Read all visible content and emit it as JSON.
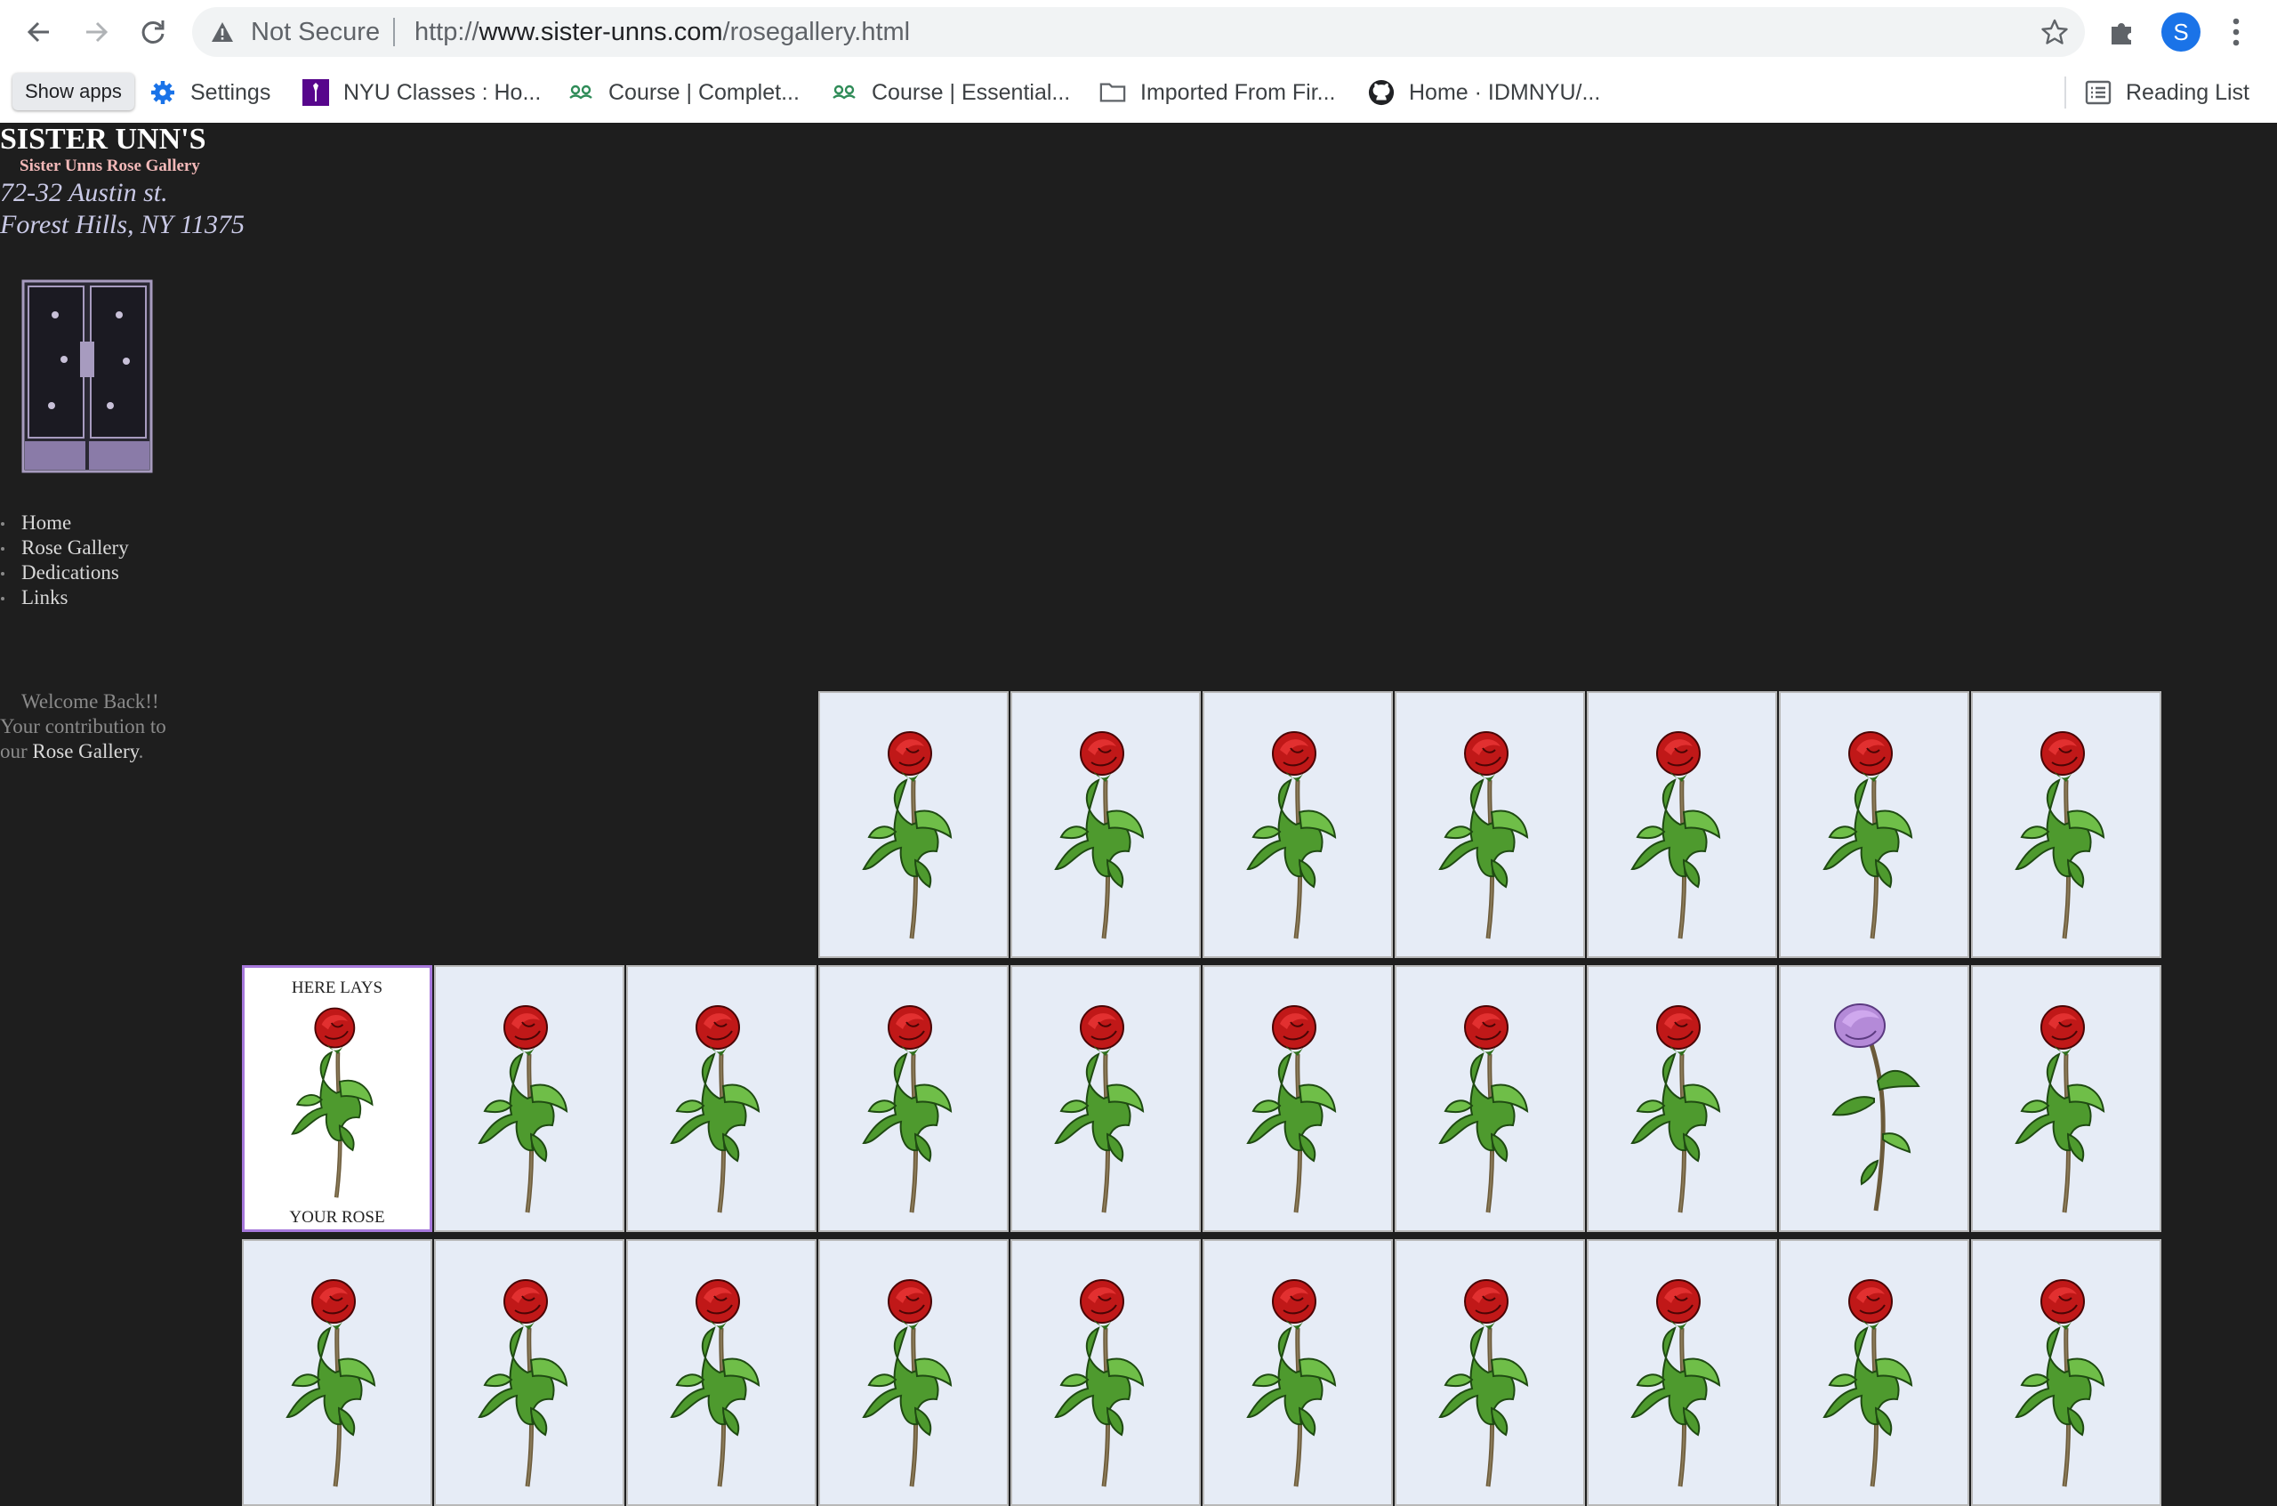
{
  "browser": {
    "security_label": "Not Secure",
    "url_scheme": "http://",
    "url_host": "www.sister-unns.com",
    "url_path": "/rosegallery.html",
    "profile_initial": "S"
  },
  "bookmarks": {
    "show_apps_label": "Show apps",
    "items": [
      {
        "label": "Settings",
        "icon": "gear-icon"
      },
      {
        "label": "NYU Classes : Ho...",
        "icon": "nyu-torch-icon"
      },
      {
        "label": "Course | Complet...",
        "icon": "edx-icon"
      },
      {
        "label": "Course | Essential...",
        "icon": "edx-icon"
      },
      {
        "label": "Imported From Fir...",
        "icon": "folder-icon"
      },
      {
        "label": "Home · IDMNYU/...",
        "icon": "github-icon"
      }
    ],
    "reading_list_label": "Reading List"
  },
  "site": {
    "title": "SISTER UNN'S",
    "subtitle": "Sister Unns Rose Gallery",
    "address_line1": "72-32 Austin st.",
    "address_line2": "Forest Hills, NY 11375"
  },
  "menu": {
    "items": [
      "Home",
      "Rose Gallery",
      "Dedications",
      "Links"
    ]
  },
  "welcome": {
    "line1": "Welcome Back!!",
    "line2": "Your contribution to",
    "line3_prefix": "our",
    "link": "Rose Gallery",
    "line3_suffix": "."
  },
  "gallery": {
    "selected_top": "HERE LAYS",
    "selected_bottom": "YOUR ROSE",
    "colors": {
      "red_rose": "#c01818",
      "purple_rose": "#b48ad8",
      "leaf": "#4e9a2e",
      "tile_bg": "#e6ecf6",
      "selected_border": "#a678db"
    }
  }
}
